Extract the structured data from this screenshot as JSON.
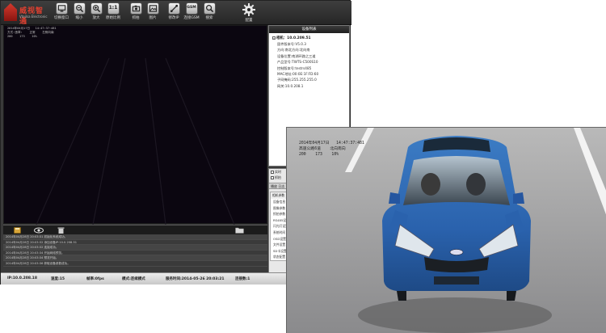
{
  "app": {
    "logo": {
      "name": "威视智通",
      "sub": "Vteilsa Electronic"
    },
    "toolbar": [
      {
        "id": "window-switch",
        "label": "切换窗口",
        "icon": "monitor-icon"
      },
      {
        "id": "zoom-out",
        "label": "缩小",
        "icon": "zoom-out-icon"
      },
      {
        "id": "zoom-in",
        "label": "放大",
        "icon": "zoom-in-icon"
      },
      {
        "id": "original-size",
        "label": "原始比例",
        "icon": "one-to-one-icon",
        "glyph": "1:1"
      },
      {
        "id": "snapshot",
        "label": "抓拍",
        "icon": "camera-icon"
      },
      {
        "id": "images",
        "label": "图片",
        "icon": "image-icon"
      },
      {
        "id": "modify-ip",
        "label": "修改IP",
        "icon": "network-icon"
      },
      {
        "id": "connect-gsm",
        "label": "连接GSM",
        "icon": "gsm-icon",
        "glyph": "GSM"
      },
      {
        "id": "search",
        "label": "搜索",
        "icon": "search-icon"
      }
    ],
    "config_label": "配置",
    "video_overlay": [
      "2014年04月17日   14:47:37:481",
      "方式:违章:    正常    左侧向南",
      "200    173    10%"
    ]
  },
  "device_list": {
    "title": "设备列表",
    "root": "相机：10.0.209.51",
    "items": [
      "固件版本号:V5.0.3",
      "方向:南北方向:北向南",
      "设备位置:南湖环路之三道",
      "产品型号:TWTS-C500S10",
      "控制版本号:testrs485",
      "MAC地址:00:0E:1F:FD:60",
      "子网掩码:255.255.255.0",
      "网关:10.0.208.1"
    ]
  },
  "mini_panel": {
    "checks": [
      "实时",
      "抓拍"
    ],
    "tabs": "播放  日志",
    "props_title": "相机参数",
    "props": [
      "设备信息",
      "图像参数",
      "抓拍参数",
      "RS485设置",
      "闪光灯设置",
      "系统时间",
      "OSD设置",
      "文件设置",
      "SD卡设置",
      "状态配置"
    ]
  },
  "log": {
    "rows": [
      "2014年04月28日 20:03:31  初始化系统成功。",
      "2014年04月28日 20:03:32  添加设备IP:10.0.208.51",
      "2014年04月28日 20:03:32  连接成功。",
      "2014年04月28日 20:03:34  开始网络预览。",
      "2014年04月28日 20:03:34  预览开始。",
      "2014年04月28日 20:03:36  获取设备参数成功。"
    ]
  },
  "status_bar": {
    "ip": "IP:10.0.208.18",
    "speed": "速度:15",
    "fps": "帧率:0fps",
    "mode": "模式:连续模式",
    "time": "服务时间:2014-05-26 20:03:21",
    "connections": "连接数:1",
    "devices": "设备数:1"
  },
  "capture": {
    "stamp": [
      "2014年04月17日   14:47:37:481",
      "高速公路6道    北向南向",
      "200    173    10%"
    ]
  },
  "colors": {
    "car_blue": "#2d68b4",
    "road": "#8c8c8e",
    "toolbar_dark": "#2a2a2a"
  }
}
